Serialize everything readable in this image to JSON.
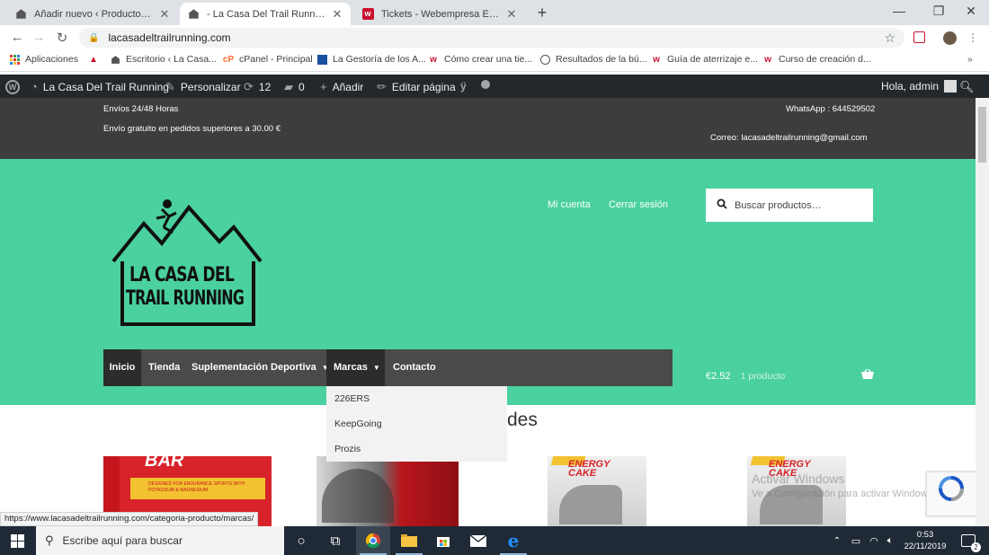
{
  "browser": {
    "tabs": [
      {
        "title": "Añadir nuevo ‹ Productos ‹ La Ca",
        "icon": "wordpress-icon",
        "active": false
      },
      {
        "title": "- La Casa Del Trail Running",
        "icon": "wordpress-icon",
        "active": true
      },
      {
        "title": "Tickets - Webempresa Europa S.L.",
        "icon": "webempresa-icon",
        "active": false
      }
    ],
    "url": "lacasadeltrailrunning.com",
    "bookmarks": [
      {
        "label": "Aplicaciones",
        "icon": "apps-grid-icon"
      },
      {
        "label": "",
        "icon": "bookmark-arrow-icon"
      },
      {
        "label": "Escritorio ‹ La Casa...",
        "icon": "wordpress-icon"
      },
      {
        "label": "cPanel - Principal",
        "icon": "cpanel-icon"
      },
      {
        "label": "La Gestoría de los A...",
        "icon": "gestoria-icon"
      },
      {
        "label": "Cómo crear una tie...",
        "icon": "webempresa-icon"
      },
      {
        "label": "Resultados de la bú...",
        "icon": "wordpress-icon"
      },
      {
        "label": "Guía de aterrizaje e...",
        "icon": "webempresa-icon"
      },
      {
        "label": "Curso de creación d...",
        "icon": "webempresa-icon"
      }
    ],
    "status_url": "https://www.lacasadeltrailrunning.com/categoria-producto/marcas/"
  },
  "adminbar": {
    "site_name": "La Casa Del Trail Running",
    "customize": "Personalizar",
    "updates": "12",
    "comments": "0",
    "add_new": "Añadir",
    "edit_page": "Editar página",
    "greeting": "Hola, admin"
  },
  "topinfo": {
    "shipping": "Envíos 24/48 Horas",
    "free_shipping": "Envío gratuito en pedidos superiores a 30.00 €",
    "whatsapp": "WhatsApp : 644529502",
    "email": "Correo: lacasadeltrailrunning@gmail.com"
  },
  "header": {
    "logo_line1": "LA CASA DEL",
    "logo_line2": "TRAIL RUNNING",
    "my_account": "Mi cuenta",
    "logout": "Cerrar sesión",
    "search_placeholder": "Buscar productos…"
  },
  "nav": {
    "items": [
      "Inicio",
      "Tienda",
      "Suplementación Deportiva",
      "Marcas",
      "Contacto"
    ],
    "active": "Inicio",
    "open": "Marcas"
  },
  "cart": {
    "total": "€2.52",
    "count": "1 producto"
  },
  "dropdown": {
    "items": [
      "226ERS",
      "KeepGoing",
      "Prozis"
    ]
  },
  "section_title_fragment": "des",
  "products": [
    {
      "label": "BAR",
      "sub": "DESIGNED FOR ENDURANCE SPORTS WITH POTASSIUM & MAGNESIUM"
    },
    {
      "label": "",
      "sub": ""
    },
    {
      "label": "ENERGY CAKE",
      "sub": ""
    },
    {
      "label": "ENERGY CAKE",
      "sub": ""
    }
  ],
  "windows": {
    "activate_title": "Activar Windows",
    "activate_sub": "Ve a Configuración para activar Windows.",
    "search_placeholder": "Escribe aquí para buscar",
    "time": "0:53",
    "date": "22/11/2019",
    "notifications": "2"
  },
  "colors": {
    "header_green": "#4ad19f",
    "topbar": "#3d3d3d",
    "nav": "#4a4a4a",
    "adminbar": "#23282d"
  }
}
